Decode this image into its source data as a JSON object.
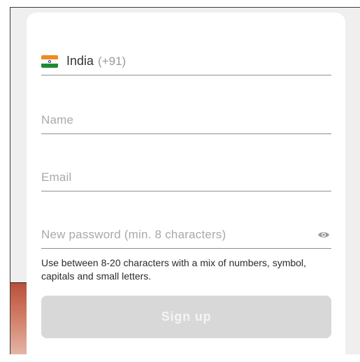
{
  "country": {
    "name": "India",
    "code": "(+91)",
    "flag_icon": "india-flag-icon"
  },
  "form": {
    "name_placeholder": "Name",
    "email_placeholder": "Email",
    "password_placeholder": "New password (min. 8 characters)",
    "password_hint": "Use between 8-20 characters with a mix of numbers, symbol, capitals and small letters.",
    "signup_label": "Sign up",
    "toggle_icon": "eye-icon"
  },
  "colors": {
    "button_disabled_bg": "#d8d8d8",
    "placeholder_text": "#a9a9a9",
    "underline": "#8f8f8f"
  }
}
